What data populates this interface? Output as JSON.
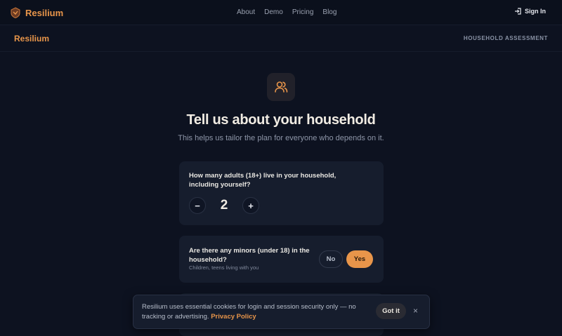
{
  "brand": {
    "name": "Resilium"
  },
  "nav": {
    "links": [
      "About",
      "Demo",
      "Pricing",
      "Blog"
    ],
    "sign_in": "Sign In"
  },
  "subheader": {
    "brand": "Resilium",
    "label": "HOUSEHOLD ASSESSMENT"
  },
  "hero": {
    "icon": "users-icon",
    "title": "Tell us about your household",
    "subtitle": "This helps us tailor the plan for everyone who depends on it."
  },
  "adults": {
    "question": "How many adults (18+) live in your household, including yourself?",
    "decrement": "−",
    "value": "2",
    "increment": "+"
  },
  "minors": {
    "question": "Are there any minors (under 18) in the household?",
    "hint": "Children, teens living with you",
    "no": "No",
    "yes": "Yes",
    "selected": "Yes"
  },
  "cookie": {
    "text": "Resilium uses essential cookies for login and session security only — no tracking or advertising.",
    "link": "Privacy Policy",
    "accept": "Got it",
    "close": "×"
  },
  "colors": {
    "accent": "#e8954a",
    "background": "#0d1220",
    "card": "#161d2d"
  }
}
